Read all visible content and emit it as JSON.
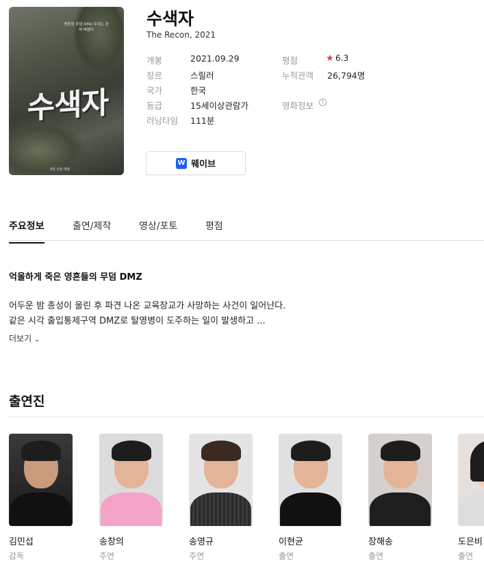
{
  "movie": {
    "title": "수색자",
    "subtitle": "The Recon, 2021",
    "poster": {
      "tagline": "영혼의 무덤 DMZ 우리는 갇 혀 버렸다",
      "title_art": "수색자",
      "credit": "8월 상영 예정"
    }
  },
  "info": {
    "release_label": "개봉",
    "release_value": "2021.09.29",
    "genre_label": "장르",
    "genre_value": "스릴러",
    "country_label": "국가",
    "country_value": "한국",
    "rating_label": "등급",
    "rating_value": "15세이상관람가",
    "runtime_label": "러닝타임",
    "runtime_value": "111분",
    "score_label": "평점",
    "score_value": "6.3",
    "audience_label": "누적관객",
    "audience_value": "26,794명",
    "movieinfo_label": "영화정보"
  },
  "watch_button": {
    "icon": "W",
    "label": "웨이브"
  },
  "tabs": [
    {
      "label": "주요정보",
      "active": true
    },
    {
      "label": "출연/제작",
      "active": false
    },
    {
      "label": "영상/포토",
      "active": false
    },
    {
      "label": "평점",
      "active": false
    }
  ],
  "synopsis": {
    "title": "억울하게 죽은 영혼들의 무덤 DMZ",
    "line1": "어두운 밤 총성이 울린 후 파견 나온 교육장교가 사망하는 사건이 일어난다.",
    "line2": "같은 시각 출입통제구역 DMZ로 탈영병이 도주하는 일이 발생하고 ...",
    "more": "더보기"
  },
  "cast_heading": "출연진",
  "cast": [
    {
      "name": "김민섭",
      "role": "감독"
    },
    {
      "name": "송창의",
      "role": "주연"
    },
    {
      "name": "송영규",
      "role": "주연"
    },
    {
      "name": "이현균",
      "role": "출연"
    },
    {
      "name": "장해송",
      "role": "출연"
    },
    {
      "name": "도은비",
      "role": "출연"
    }
  ],
  "colors": {
    "star": "#f1323e",
    "wavve": "#1a5cff",
    "label_gray": "#999999"
  }
}
